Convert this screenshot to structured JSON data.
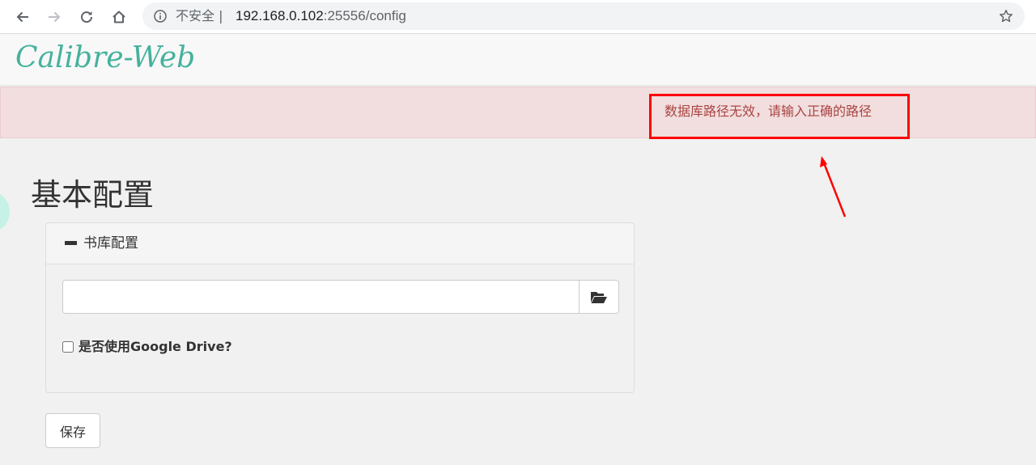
{
  "browser": {
    "security_label": "不安全 |",
    "url_host": "192.168.0.102",
    "url_rest": ":25556/config",
    "icons": [
      "back-arrow-icon",
      "forward-arrow-icon",
      "reload-icon",
      "home-icon",
      "info-icon",
      "star-icon"
    ]
  },
  "site": {
    "logo_text": "Calibre-Web",
    "brand_color": "#45b29d"
  },
  "alert": {
    "message": "数据库路径无效，请输入正确的路径",
    "color": "#a94442",
    "background": "#f2dede"
  },
  "annotation": {
    "highlight_color": "#ff0000"
  },
  "page": {
    "title": "基本配置"
  },
  "panel": {
    "heading": "书库配置",
    "heading_icon": "minus-icon",
    "path_input_value": "",
    "folder_button_icon": "folder-open-icon",
    "gdrive_checked": false,
    "gdrive_label": "是否使用Google Drive?"
  },
  "actions": {
    "save_label": "保存"
  }
}
